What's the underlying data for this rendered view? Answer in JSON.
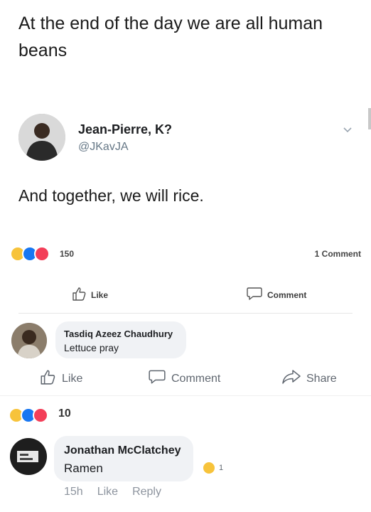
{
  "post": {
    "text": "At the end of the day we are all human beans"
  },
  "tweet": {
    "author_name": "Jean-Pierre, K?",
    "author_handle": "@JKavJA",
    "text": "And together, we will rice."
  },
  "fb_post": {
    "reaction_count": "150",
    "comment_count": "1 Comment",
    "like_label": "Like",
    "comment_label": "Comment"
  },
  "comment1": {
    "author": "Tasdiq Azeez Chaudhury",
    "text": "Lettuce pray",
    "like_label": "Like",
    "comment_label": "Comment",
    "share_label": "Share",
    "reaction_count": "10"
  },
  "comment2": {
    "author": "Jonathan McClatchey",
    "text": "Ramen",
    "reaction_count": "1",
    "time": "15h",
    "like_label": "Like",
    "reply_label": "Reply"
  },
  "colors": {
    "like_blue": "#1877f2",
    "haha_yellow": "#f7c33b",
    "secondary_text": "#8d949e"
  }
}
